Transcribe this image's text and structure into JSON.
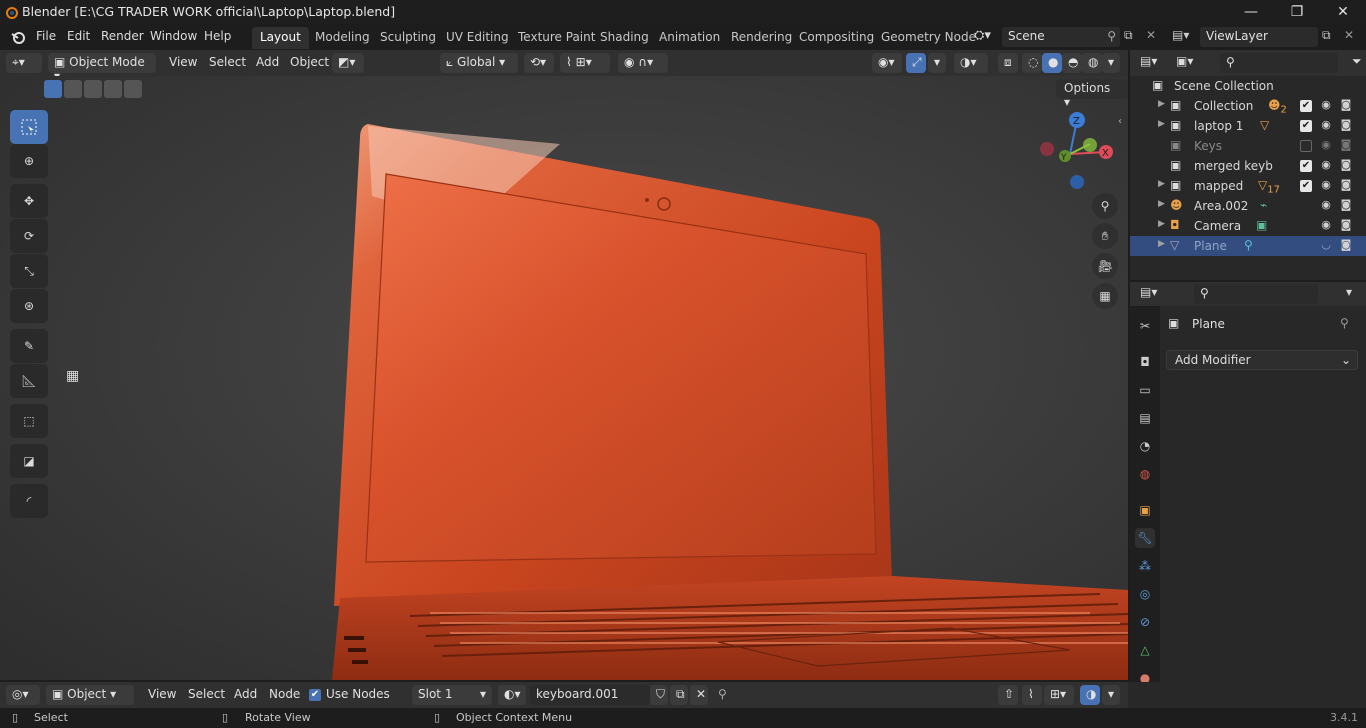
{
  "window": {
    "title": "Blender [E:\\CG TRADER WORK official\\Laptop\\Laptop.blend]",
    "controls": [
      "—",
      "❐",
      "✕"
    ]
  },
  "menu": {
    "items": [
      "File",
      "Edit",
      "Render",
      "Window",
      "Help"
    ],
    "workspaces": [
      "Layout",
      "Modeling",
      "Sculpting",
      "UV Editing",
      "Texture Paint",
      "Shading",
      "Animation",
      "Rendering",
      "Compositing",
      "Geometry Node"
    ],
    "active_workspace": "Layout",
    "scene": "Scene",
    "view_layer": "ViewLayer"
  },
  "viewport_header": {
    "mode": "Object Mode",
    "menus": [
      "View",
      "Select",
      "Add",
      "Object"
    ],
    "orientation": "Global",
    "options_label": "Options"
  },
  "gizmo": {
    "x": "X",
    "y": "Y",
    "z": "Z"
  },
  "outliner": {
    "root": "Scene Collection",
    "rows": [
      {
        "label": "Collection",
        "icon": "collection-icon",
        "badge": "2",
        "checked": true
      },
      {
        "label": "laptop 1",
        "icon": "collection-icon",
        "checked": true
      },
      {
        "label": "Keys",
        "icon": "collection-icon",
        "checked": false,
        "muted": true
      },
      {
        "label": "merged keyb",
        "icon": "collection-icon",
        "checked": true
      },
      {
        "label": "mapped",
        "icon": "collection-icon",
        "badge": "17",
        "checked": true
      },
      {
        "label": "Area.002",
        "icon": "light-icon"
      },
      {
        "label": "Camera",
        "icon": "camera-icon"
      },
      {
        "label": "Plane",
        "icon": "mesh-icon",
        "selected": true
      }
    ]
  },
  "properties": {
    "object_name": "Plane",
    "add_modifier": "Add Modifier"
  },
  "shader_header": {
    "editor_type": "Object",
    "menus": [
      "View",
      "Select",
      "Add",
      "Node"
    ],
    "use_nodes_label": "Use Nodes",
    "use_nodes": true,
    "slot": "Slot 1",
    "material": "keyboard.001"
  },
  "status": {
    "select": "Select",
    "rotate": "Rotate View",
    "context_menu": "Object Context Menu",
    "version": "3.4.1"
  },
  "colors": {
    "accent": "#4772b3",
    "laptop": "#d9512a"
  }
}
